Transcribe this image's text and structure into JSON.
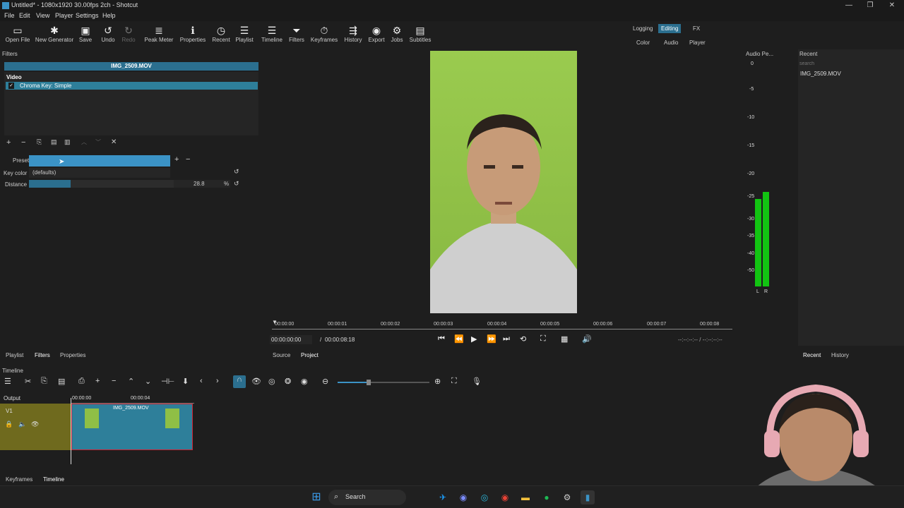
{
  "window": {
    "title": "Untitled* - 1080x1920 30.00fps 2ch - Shotcut"
  },
  "menu": [
    "File",
    "Edit",
    "View",
    "Player",
    "Settings",
    "Help"
  ],
  "toolbar": [
    {
      "label": "Open File",
      "icon": "folder-icon"
    },
    {
      "label": "New Generator",
      "icon": "generator-icon"
    },
    {
      "label": "Save",
      "icon": "save-icon"
    },
    {
      "label": "Undo",
      "icon": "undo-icon"
    },
    {
      "label": "Redo",
      "icon": "redo-icon"
    },
    {
      "label": "Peak Meter",
      "icon": "peak-meter-icon"
    },
    {
      "label": "Properties",
      "icon": "info-icon"
    },
    {
      "label": "Recent",
      "icon": "clock-icon"
    },
    {
      "label": "Playlist",
      "icon": "list-icon"
    },
    {
      "label": "Timeline",
      "icon": "timeline-icon"
    },
    {
      "label": "Filters",
      "icon": "filter-icon"
    },
    {
      "label": "Keyframes",
      "icon": "stopwatch-icon"
    },
    {
      "label": "History",
      "icon": "history-icon"
    },
    {
      "label": "Export",
      "icon": "export-icon"
    },
    {
      "label": "Jobs",
      "icon": "gear-icon"
    },
    {
      "label": "Subtitles",
      "icon": "subtitles-icon"
    }
  ],
  "layouts": {
    "row1": [
      "Logging",
      "Editing",
      "FX"
    ],
    "row2": [
      "Color",
      "Audio",
      "Player"
    ],
    "active": "Editing"
  },
  "filters": {
    "panel_title": "Filters",
    "clip_name": "IMG_2509.MOV",
    "section": "Video",
    "items": [
      {
        "label": "Chroma Key: Simple",
        "checked": "✓"
      }
    ],
    "preset_label": "Preset",
    "preset_value": "",
    "key_color_label": "Key color",
    "defaults": "(defaults)",
    "distance_label": "Distance",
    "distance_value": "28.8",
    "distance_unit": "%",
    "distance_fraction": 0.288
  },
  "left_tabs": [
    "Playlist",
    "Filters",
    "Properties"
  ],
  "player": {
    "ruler": [
      "00:00:00",
      "00:00:01",
      "00:00:02",
      "00:00:03",
      "00:00:04",
      "00:00:05",
      "00:00:06",
      "00:00:07",
      "00:00:08"
    ],
    "timecode": "00:00:00:00",
    "duration": "00:00:08:18",
    "in_out": "--:--:--:-- / --:--:--:--",
    "tabs": [
      "Source",
      "Project"
    ]
  },
  "audio": {
    "title": "Audio Pe...",
    "scale": [
      "0",
      "-5",
      "-10",
      "-15",
      "-20",
      "-25",
      "-30",
      "-35",
      "-40",
      "-50"
    ],
    "channels": [
      "L",
      "R"
    ],
    "meter_color": "#12c412"
  },
  "recent": {
    "title": "Recent",
    "search_placeholder": "search",
    "items": [
      "IMG_2509.MOV"
    ],
    "tabs": [
      "Recent",
      "History"
    ]
  },
  "timeline": {
    "title": "Timeline",
    "output_label": "Output",
    "track": "V1",
    "ruler": [
      "00:00:00",
      "00:00:04"
    ],
    "clip_label": "IMG_2509.MOV"
  },
  "bottom_tabs": [
    "Keyframes",
    "Timeline"
  ],
  "taskbar": {
    "search": "Search"
  },
  "colors": {
    "accent": "#2b6f8f",
    "selection": "#3b93c6",
    "track": "#6f6a1e",
    "clip": "#2e7f9a"
  }
}
